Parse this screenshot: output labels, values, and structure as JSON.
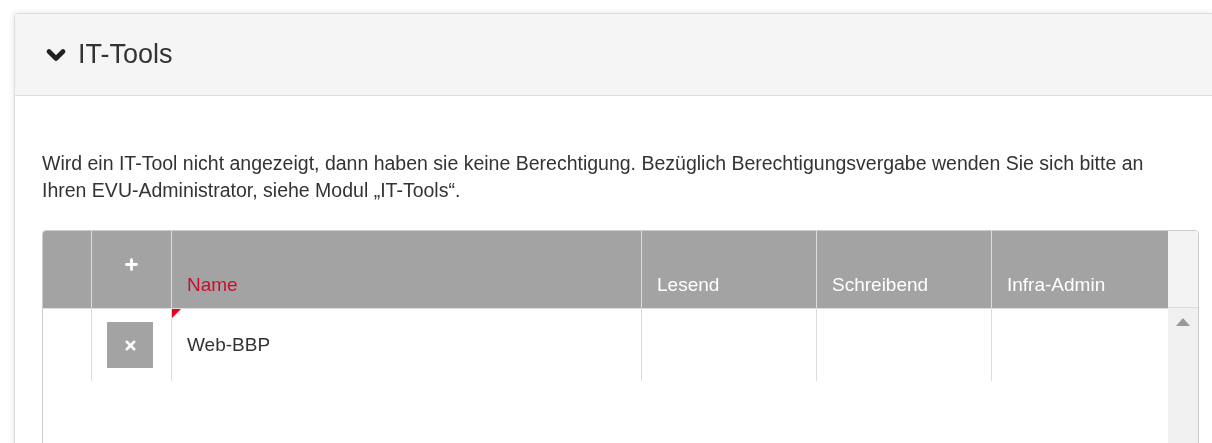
{
  "panel": {
    "title": "IT-Tools",
    "expanded": true
  },
  "notice": "Wird ein IT-Tool nicht angezeigt, dann haben sie keine Berechtigung. Bezüglich Berechtigungsvergabe wenden Sie sich bitte an Ihren EVU-Administrator, siehe Modul „IT-Tools“.",
  "table": {
    "columns": [
      {
        "label": "Name",
        "sorted": true
      },
      {
        "label": "Lesend",
        "sorted": false
      },
      {
        "label": "Schreibend",
        "sorted": false
      },
      {
        "label": "Infra-Admin",
        "sorted": false
      }
    ],
    "rows": [
      {
        "name": "Web-BBP",
        "changed": true
      }
    ]
  }
}
